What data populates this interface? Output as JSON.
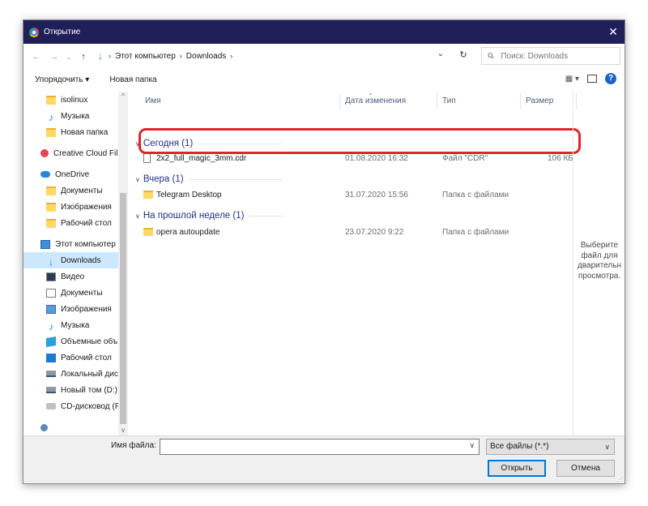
{
  "window": {
    "title": "Открытие",
    "close": "✕"
  },
  "nav": {
    "back": "←",
    "forward": "→",
    "recent": "⌄",
    "up": "↑"
  },
  "address": {
    "icon": "download-icon",
    "segments": [
      "Этот компьютер",
      "Downloads"
    ],
    "dropdown": "⌄",
    "refresh": "↻"
  },
  "search": {
    "placeholder": "Поиск: Downloads",
    "icon": "⚲"
  },
  "toolbar": {
    "organize": "Упорядочить ▾",
    "new_folder": "Новая папка",
    "view": "▦ ▾",
    "help": "?"
  },
  "sidebar": {
    "items": [
      {
        "label": "isolinux",
        "icon": "folder-icon"
      },
      {
        "label": "Музыка",
        "icon": "music-icon"
      },
      {
        "label": "Новая папка",
        "icon": "folder-icon"
      },
      {
        "label": "Creative Cloud Fil",
        "icon": "creative-cloud-icon"
      },
      {
        "label": "OneDrive",
        "icon": "onedrive-icon"
      },
      {
        "label": "Документы",
        "icon": "folder-icon"
      },
      {
        "label": "Изображения",
        "icon": "folder-icon"
      },
      {
        "label": "Рабочий стол",
        "icon": "folder-icon"
      },
      {
        "label": "Этот компьютер",
        "icon": "computer-icon"
      },
      {
        "label": "Downloads",
        "icon": "download-icon",
        "selected": true
      },
      {
        "label": "Видео",
        "icon": "video-icon"
      },
      {
        "label": "Документы",
        "icon": "document-icon"
      },
      {
        "label": "Изображения",
        "icon": "image-icon"
      },
      {
        "label": "Музыка",
        "icon": "music-icon"
      },
      {
        "label": "Объемные объ",
        "icon": "3d-objects-icon"
      },
      {
        "label": "Рабочий стол",
        "icon": "desktop-icon"
      },
      {
        "label": "Локальный дис",
        "icon": "local-disk-icon"
      },
      {
        "label": "Новый том (D:)",
        "icon": "drive-icon"
      },
      {
        "label": "CD-дисковод (F",
        "icon": "cd-drive-icon"
      }
    ]
  },
  "columns": {
    "name": "Имя",
    "date": "Дата изменения",
    "type": "Тип",
    "size": "Размер"
  },
  "groups": [
    {
      "title": "Сегодня (1)",
      "rows": [
        {
          "name": "2x2_full_magic_3mm.cdr",
          "date": "01.08.2020 16:32",
          "type": "Файл \"CDR\"",
          "size": "106 КБ",
          "icon": "file-icon"
        }
      ]
    },
    {
      "title": "Вчера (1)",
      "rows": [
        {
          "name": "Telegram Desktop",
          "date": "31.07.2020 15:56",
          "type": "Папка с файлами",
          "size": "",
          "icon": "folder-icon"
        }
      ]
    },
    {
      "title": "На прошлой неделе (1)",
      "rows": [
        {
          "name": "opera autoupdate",
          "date": "23.07.2020 9:22",
          "type": "Папка с файлами",
          "size": "",
          "icon": "folder-icon"
        }
      ]
    }
  ],
  "preview": {
    "lines": [
      "Выберите",
      "файл для",
      "дварительн",
      "просмотра."
    ]
  },
  "bottom": {
    "filename_label": "Имя файла:",
    "filename_value": "",
    "filetype": "Все файлы (*.*)",
    "open": "Открыть",
    "cancel": "Отмена"
  },
  "colors": {
    "title_bg": "#1f1f5a",
    "selection": "#cce8ff",
    "group_text": "#1e3287",
    "highlight_frame": "#e0242c",
    "primary_border": "#0078d7"
  }
}
